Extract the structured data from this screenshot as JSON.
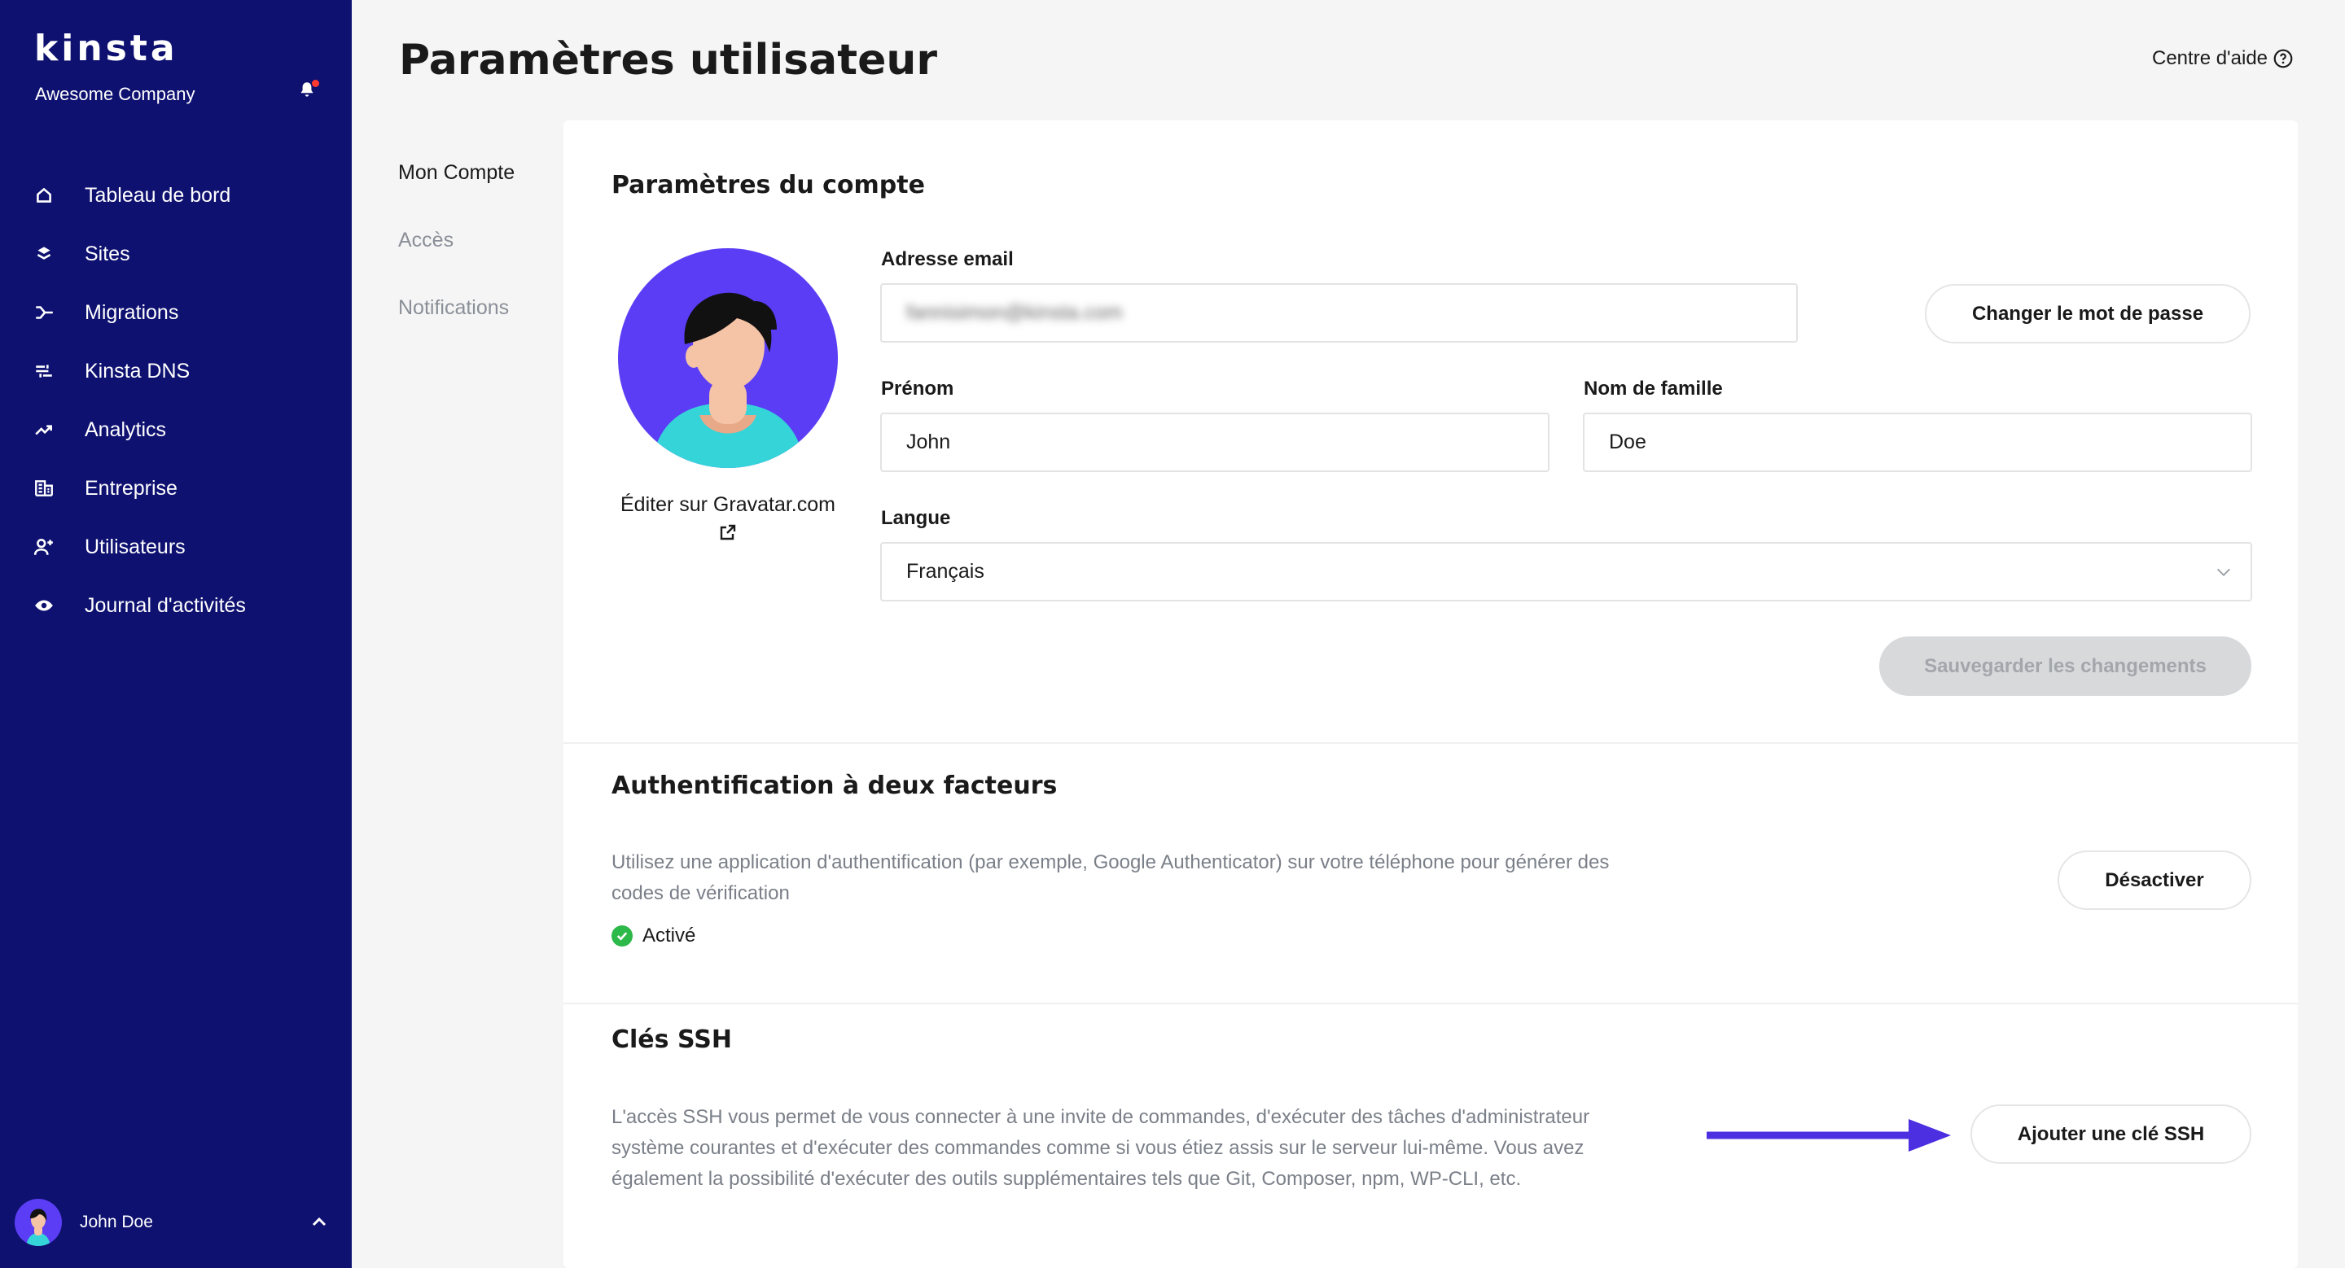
{
  "sidebar": {
    "logo": "kinsta",
    "company": "Awesome Company",
    "items": [
      {
        "label": "Tableau de bord",
        "icon": "home-icon"
      },
      {
        "label": "Sites",
        "icon": "layers-icon"
      },
      {
        "label": "Migrations",
        "icon": "migrate-icon"
      },
      {
        "label": "Kinsta DNS",
        "icon": "dns-icon"
      },
      {
        "label": "Analytics",
        "icon": "trend-icon"
      },
      {
        "label": "Entreprise",
        "icon": "building-icon"
      },
      {
        "label": "Utilisateurs",
        "icon": "add-user-icon"
      },
      {
        "label": "Journal d'activités",
        "icon": "eye-icon"
      }
    ],
    "user_name": "John Doe"
  },
  "header": {
    "title": "Paramètres utilisateur",
    "help_label": "Centre d'aide"
  },
  "subnav": {
    "items": [
      "Mon Compte",
      "Accès",
      "Notifications"
    ]
  },
  "account": {
    "title": "Paramètres du compte",
    "gravatar_label": "Éditer sur Gravatar.com",
    "email_label": "Adresse email",
    "email_value": "fannisimon@kinsta.com",
    "change_password": "Changer le mot de passe",
    "firstname_label": "Prénom",
    "firstname_value": "John",
    "lastname_label": "Nom de famille",
    "lastname_value": "Doe",
    "language_label": "Langue",
    "language_value": "Français",
    "save_label": "Sauvegarder les changements"
  },
  "twofa": {
    "title": "Authentification à deux facteurs",
    "line1": "Utilisez une application d'authentification (par exemple, Google Authenticator) sur votre téléphone pour générer des",
    "line2": "codes de vérification",
    "status": "Activé",
    "disable_label": "Désactiver"
  },
  "ssh": {
    "title": "Clés SSH",
    "line1": "L'accès SSH vous permet de vous connecter à une invite de commandes, d'exécuter des tâches d'administrateur",
    "line2": "système courantes et d'exécuter des commandes comme si vous étiez assis sur le serveur lui-même. Vous avez",
    "line3": "également la possibilité d'exécuter des outils supplémentaires tels que Git, Composer, npm, WP-CLI, etc.",
    "add_label": "Ajouter une clé SSH"
  },
  "colors": {
    "sidebar": "#0e1170",
    "accent": "#5b3df5",
    "arrow": "#4b2fe0",
    "success": "#2db84a"
  }
}
